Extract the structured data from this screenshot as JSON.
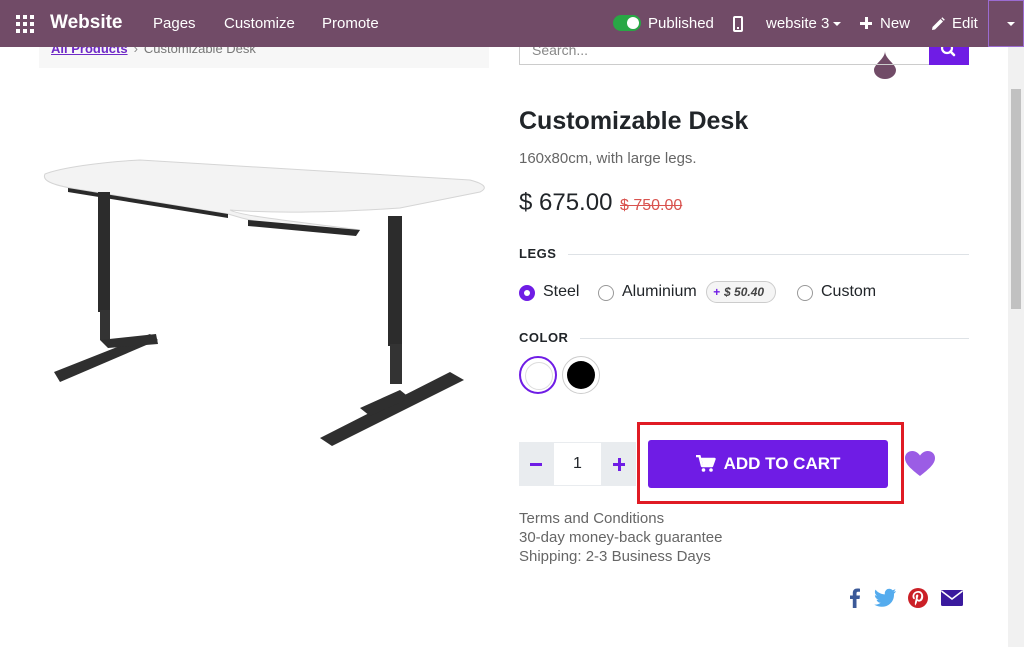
{
  "topbar": {
    "brand": "Website",
    "menu": [
      "Pages",
      "Customize",
      "Promote"
    ],
    "published_label": "Published",
    "site_selector": "website 3",
    "new_label": "New",
    "edit_label": "Edit",
    "color": "#714B67"
  },
  "breadcrumb": {
    "parent": "All Products",
    "current": "Customizable Desk"
  },
  "search": {
    "placeholder": "Search..."
  },
  "product": {
    "name": "Customizable Desk",
    "description": "160x80cm, with large legs.",
    "price": "$ 675.00",
    "old_price": "$ 750.00"
  },
  "legs": {
    "label": "LEGS",
    "options": [
      "Steel",
      "Aluminium",
      "Custom"
    ],
    "selected": "Steel",
    "aluminium_extra": "$ 50.40"
  },
  "color": {
    "label": "COLOR",
    "options": [
      "White",
      "Black"
    ],
    "selected": "White"
  },
  "quantity": {
    "value": "1"
  },
  "cart": {
    "add_label": "ADD TO CART",
    "accent": "#6f1ce5"
  },
  "terms": {
    "line1": "Terms and Conditions",
    "line2": "30-day money-back guarantee",
    "line3": "Shipping: 2-3 Business Days"
  },
  "social": [
    "facebook-icon",
    "twitter-icon",
    "pinterest-icon",
    "email-icon"
  ]
}
